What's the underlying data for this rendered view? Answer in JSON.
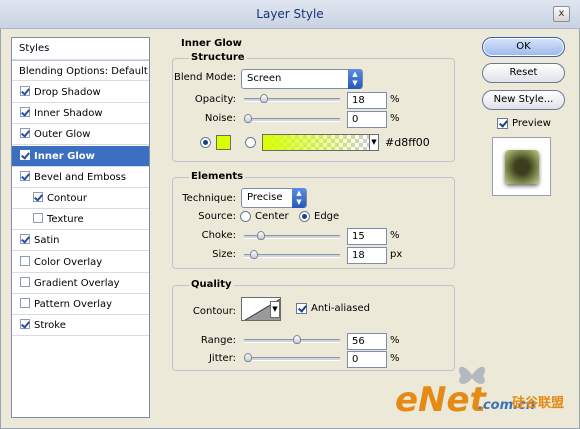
{
  "window": {
    "title": "Layer Style",
    "close_label": "x"
  },
  "sidebar": {
    "header": "Styles",
    "blending": "Blending Options: Default",
    "items": [
      {
        "label": "Drop Shadow",
        "checked": true,
        "sub": false,
        "selected": false
      },
      {
        "label": "Inner Shadow",
        "checked": true,
        "sub": false,
        "selected": false
      },
      {
        "label": "Outer Glow",
        "checked": true,
        "sub": false,
        "selected": false
      },
      {
        "label": "Inner Glow",
        "checked": true,
        "sub": false,
        "selected": true
      },
      {
        "label": "Bevel and Emboss",
        "checked": true,
        "sub": false,
        "selected": false
      },
      {
        "label": "Contour",
        "checked": true,
        "sub": true,
        "selected": false
      },
      {
        "label": "Texture",
        "checked": false,
        "sub": true,
        "selected": false
      },
      {
        "label": "Satin",
        "checked": true,
        "sub": false,
        "selected": false
      },
      {
        "label": "Color Overlay",
        "checked": false,
        "sub": false,
        "selected": false
      },
      {
        "label": "Gradient Overlay",
        "checked": false,
        "sub": false,
        "selected": false
      },
      {
        "label": "Pattern Overlay",
        "checked": false,
        "sub": false,
        "selected": false
      },
      {
        "label": "Stroke",
        "checked": true,
        "sub": false,
        "selected": false
      }
    ]
  },
  "inner_glow": {
    "title": "Inner Glow",
    "structure": {
      "legend": "Structure",
      "blend_mode_label": "Blend Mode:",
      "blend_mode_value": "Screen",
      "opacity_label": "Opacity:",
      "opacity_value": "18",
      "opacity_unit": "%",
      "opacity_level": 0.18,
      "noise_label": "Noise:",
      "noise_value": "0",
      "noise_unit": "%",
      "noise_level": 0,
      "glow_color": "#d8ff00",
      "glow_hex_label": "#d8ff00"
    },
    "elements": {
      "legend": "Elements",
      "technique_label": "Technique:",
      "technique_value": "Precise",
      "source_label": "Source:",
      "source_center": "Center",
      "source_edge": "Edge",
      "choke_label": "Choke:",
      "choke_value": "15",
      "choke_unit": "%",
      "choke_level": 0.15,
      "size_label": "Size:",
      "size_value": "18",
      "size_unit": "px",
      "size_level": 0.072
    },
    "quality": {
      "legend": "Quality",
      "contour_label": "Contour:",
      "antialiased_label": "Anti-aliased",
      "range_label": "Range:",
      "range_value": "56",
      "range_unit": "%",
      "range_level": 0.56,
      "jitter_label": "Jitter:",
      "jitter_value": "0",
      "jitter_unit": "%",
      "jitter_level": 0
    }
  },
  "actions": {
    "ok": "OK",
    "reset": "Reset",
    "new_style": "New Style...",
    "preview_label": "Preview",
    "preview_checked": true
  },
  "watermark": {
    "text": "eNet",
    "domain": ".com.cn",
    "chinese": "硅谷联盟"
  }
}
